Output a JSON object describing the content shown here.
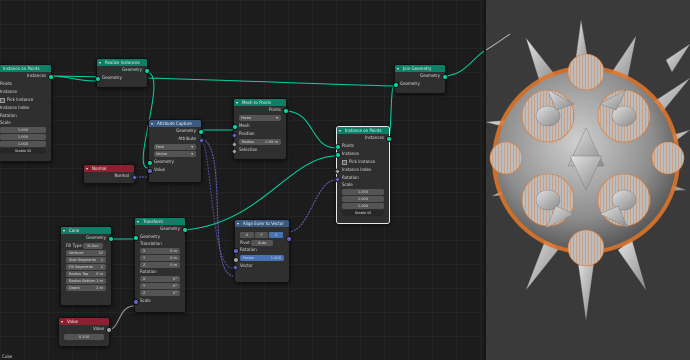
{
  "status_object": "Cube",
  "nodes": {
    "instance_on_points_left": {
      "title": "Instance on Points",
      "out_instances": "Instances",
      "points": "Points",
      "instance": "Instance",
      "pick_instance": "Pick Instance",
      "instance_index": "Instance Index",
      "rotation": "Rotation",
      "scale": "Scale",
      "scale_vals": [
        "1.000",
        "1.000",
        "1.000"
      ],
      "stable_id": "Stable ID"
    },
    "realize_instances": {
      "title": "Realize Instances",
      "out": "Geometry",
      "in": "Geometry"
    },
    "join_geometry": {
      "title": "Join Geometry",
      "out": "Geometry",
      "in": "Geometry"
    },
    "attribute_capture": {
      "title": "Attribute Capture",
      "out_geometry": "Geometry",
      "out_attribute": "Attribute",
      "domain": "Face",
      "type": "Vector",
      "in_geometry": "Geometry",
      "in_value": "Value"
    },
    "normal": {
      "title": "Normal",
      "out": "Normal"
    },
    "mesh_to_points": {
      "title": "Mesh to Points",
      "out": "Points",
      "mode": "Faces",
      "mesh": "Mesh",
      "position": "Position",
      "radius_label": "Radius",
      "radius_val": "0.05 m",
      "selection": "Selection"
    },
    "instance_on_points_right": {
      "title": "Instance on Points",
      "out_instances": "Instances",
      "points": "Points",
      "instance": "Instance",
      "pick_instance": "Pick Instance",
      "instance_index": "Instance Index",
      "rotation": "Rotation",
      "scale": "Scale",
      "scale_vals": [
        "1.000",
        "1.000",
        "1.000"
      ],
      "stable_id": "Stable ID"
    },
    "cone": {
      "title": "Cone",
      "out": "Geometry",
      "fill_type_label": "Fill Type",
      "fill_type": "N-Gon",
      "vertices_label": "Vertices",
      "vertices": "32",
      "side_segments_label": "Side Segments",
      "side_segments": "1",
      "fill_segments_label": "Fill Segments",
      "fill_segments": "1",
      "radius_top_label": "Radius Top",
      "radius_top": "0 m",
      "radius_bottom_label": "Radius Bottom",
      "radius_bottom": "1 m",
      "depth_label": "Depth",
      "depth": "2 m"
    },
    "transform": {
      "title": "Transform",
      "out": "Geometry",
      "in": "Geometry",
      "translation": "Translation",
      "t": [
        {
          "a": "X",
          "v": "0 m"
        },
        {
          "a": "Y",
          "v": "0 m"
        },
        {
          "a": "Z",
          "v": "0 m"
        }
      ],
      "rotation": "Rotation",
      "r": [
        {
          "a": "X",
          "v": "0°"
        },
        {
          "a": "Y",
          "v": "0°"
        },
        {
          "a": "Z",
          "v": "0°"
        }
      ],
      "scale": "Scale"
    },
    "align_euler": {
      "title": "Align Euler to Vector",
      "axes": [
        "X",
        "Y",
        "Z"
      ],
      "active_axis": "Z",
      "pivot_label": "Pivot",
      "pivot": "Auto",
      "rotation": "Rotation",
      "factor_label": "Factor",
      "factor": "1.000",
      "vector": "Vector"
    },
    "value": {
      "title": "Value",
      "out": "Value",
      "val": "0.100"
    }
  },
  "colors": {
    "geometry_socket": "#00d6a3",
    "vector_socket": "#6363c7",
    "float_socket": "#a1a1a1",
    "header_green": "#0c7f66",
    "header_blue": "#3b5a82",
    "header_red": "#8b2030",
    "mesh_orange": "#e0762a"
  }
}
